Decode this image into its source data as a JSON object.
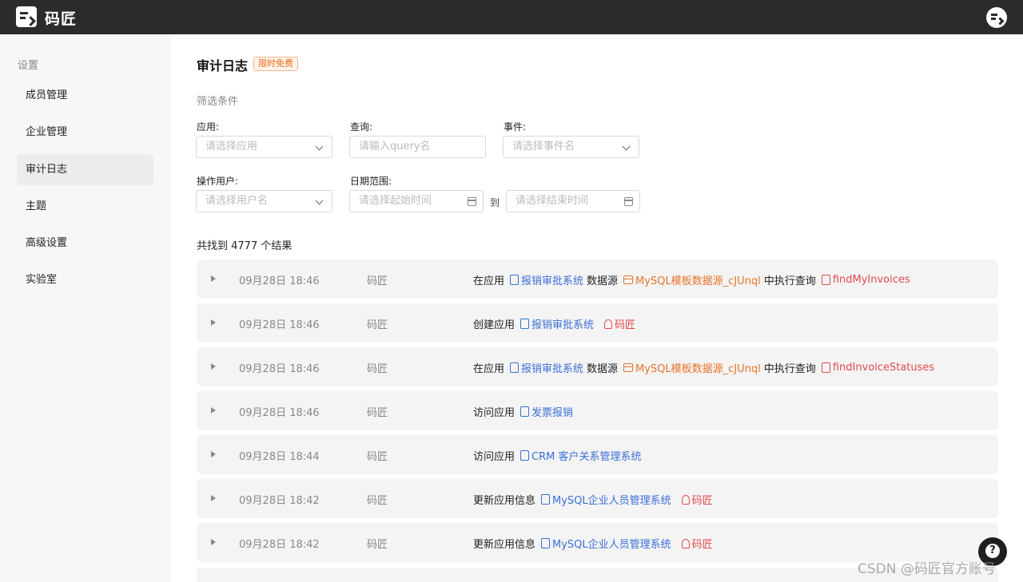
{
  "app": {
    "brand": "码匠"
  },
  "sidebar": {
    "title": "设置",
    "items": [
      {
        "label": "成员管理",
        "active": false
      },
      {
        "label": "企业管理",
        "active": false
      },
      {
        "label": "审计日志",
        "active": true
      },
      {
        "label": "主题",
        "active": false
      },
      {
        "label": "高级设置",
        "active": false
      },
      {
        "label": "实验室",
        "active": false
      }
    ]
  },
  "page": {
    "title": "审计日志",
    "badge": "限时免费"
  },
  "filters": {
    "title": "筛选条件",
    "app_label": "应用:",
    "app_placeholder": "请选择应用",
    "query_label": "查询:",
    "query_placeholder": "请输入query名",
    "event_label": "事件:",
    "event_placeholder": "请选择事件名",
    "user_label": "操作用户:",
    "user_placeholder": "请选择用户名",
    "date_label": "日期范围:",
    "date_start_placeholder": "请选择起始时间",
    "date_to": "到",
    "date_end_placeholder": "请选择结束时间"
  },
  "results": {
    "count_text": "共找到 4777 个结果",
    "rows": [
      {
        "time": "09月28日 18:46",
        "user": "码匠",
        "parts": [
          {
            "t": "text",
            "v": "在应用"
          },
          {
            "t": "app",
            "v": "报销审批系统"
          },
          {
            "t": "text",
            "v": "数据源"
          },
          {
            "t": "ds",
            "v": "MySQL模板数据源_cJUnql"
          },
          {
            "t": "text",
            "v": "中执行查询"
          },
          {
            "t": "q",
            "v": "findMyInvoices"
          }
        ]
      },
      {
        "time": "09月28日 18:46",
        "user": "码匠",
        "parts": [
          {
            "t": "text",
            "v": "创建应用"
          },
          {
            "t": "app",
            "v": "报销审批系统"
          },
          {
            "t": "user",
            "v": "码匠"
          }
        ]
      },
      {
        "time": "09月28日 18:46",
        "user": "码匠",
        "parts": [
          {
            "t": "text",
            "v": "在应用"
          },
          {
            "t": "app",
            "v": "报销审批系统"
          },
          {
            "t": "text",
            "v": "数据源"
          },
          {
            "t": "ds",
            "v": "MySQL模板数据源_cJUnql"
          },
          {
            "t": "text",
            "v": "中执行查询"
          },
          {
            "t": "q",
            "v": "findInvoiceStatuses"
          }
        ]
      },
      {
        "time": "09月28日 18:46",
        "user": "码匠",
        "parts": [
          {
            "t": "text",
            "v": "访问应用"
          },
          {
            "t": "app",
            "v": "发票报销"
          }
        ]
      },
      {
        "time": "09月28日 18:44",
        "user": "码匠",
        "parts": [
          {
            "t": "text",
            "v": "访问应用"
          },
          {
            "t": "app",
            "v": "CRM 客户关系管理系统"
          }
        ]
      },
      {
        "time": "09月28日 18:42",
        "user": "码匠",
        "parts": [
          {
            "t": "text",
            "v": "更新应用信息"
          },
          {
            "t": "app",
            "v": "MySQL企业人员管理系统"
          },
          {
            "t": "user",
            "v": "码匠"
          }
        ]
      },
      {
        "time": "09月28日 18:42",
        "user": "码匠",
        "parts": [
          {
            "t": "text",
            "v": "更新应用信息"
          },
          {
            "t": "app",
            "v": "MySQL企业人员管理系统"
          },
          {
            "t": "user",
            "v": "码匠"
          }
        ]
      }
    ]
  },
  "help": {
    "glyph": "?"
  },
  "watermark": "CSDN @码匠官方账号",
  "colors": {
    "topbar": "#2b2b2b",
    "app_link": "#3b6fd8",
    "datasource_link": "#e8742a",
    "query_link": "#e04a4a",
    "badge": "#ee6a16"
  }
}
